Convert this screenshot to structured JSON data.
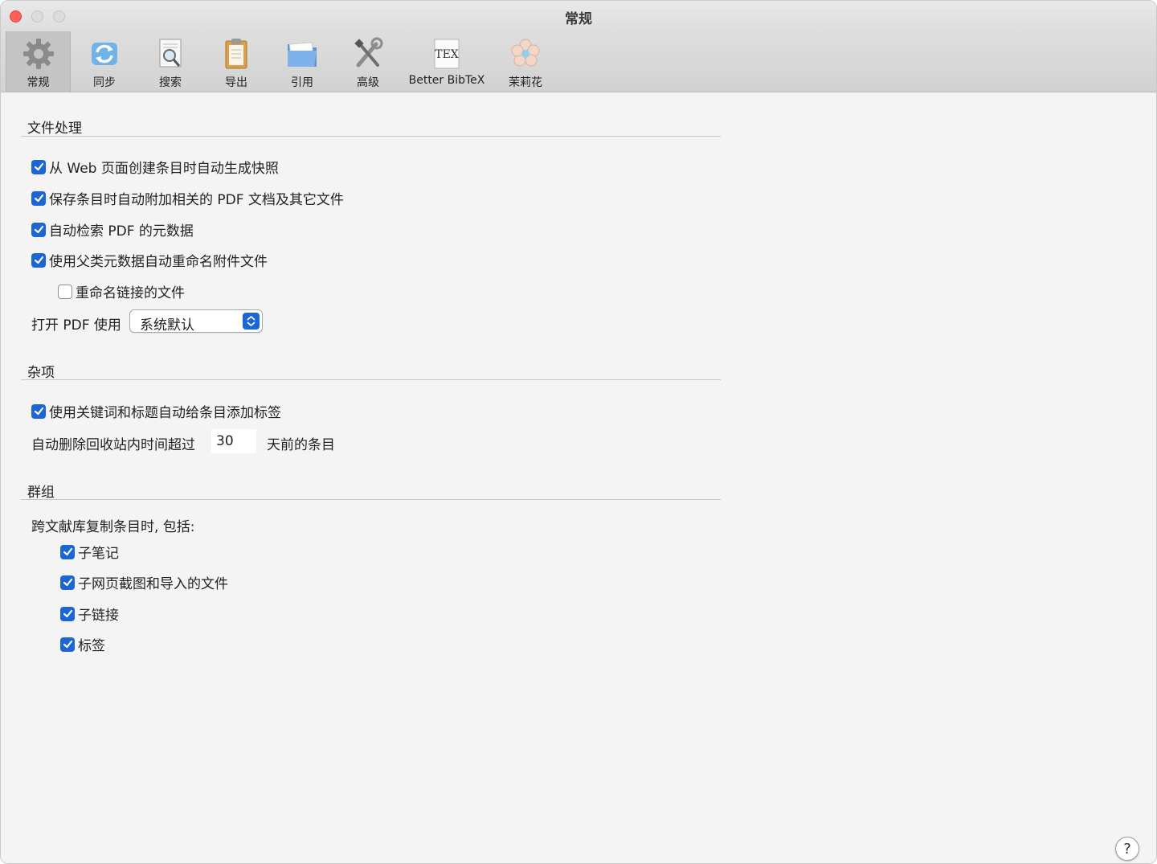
{
  "window": {
    "title": "常规"
  },
  "toolbar": {
    "items": [
      {
        "label": "常规",
        "icon": "gear-icon",
        "active": true
      },
      {
        "label": "同步",
        "icon": "sync-icon",
        "active": false
      },
      {
        "label": "搜索",
        "icon": "search-icon",
        "active": false
      },
      {
        "label": "导出",
        "icon": "clipboard-icon",
        "active": false
      },
      {
        "label": "引用",
        "icon": "folder-icon",
        "active": false
      },
      {
        "label": "高级",
        "icon": "tools-icon",
        "active": false
      },
      {
        "label": "Better BibTeX",
        "icon": "tex-icon",
        "active": false,
        "icon_text": "TEX"
      },
      {
        "label": "茉莉花",
        "icon": "flower-icon",
        "active": false
      }
    ]
  },
  "file_handling": {
    "title": "文件处理",
    "options": [
      {
        "label": "从 Web 页面创建条目时自动生成快照",
        "checked": true
      },
      {
        "label": "保存条目时自动附加相关的 PDF 文档及其它文件",
        "checked": true
      },
      {
        "label": "自动检索 PDF 的元数据",
        "checked": true
      },
      {
        "label": "使用父类元数据自动重命名附件文件",
        "checked": true
      },
      {
        "label": "重命名链接的文件",
        "checked": false
      }
    ],
    "open_pdf_label": "打开 PDF 使用",
    "open_pdf_value": "系统默认"
  },
  "misc": {
    "title": "杂项",
    "auto_tag_label": "使用关键词和标题自动给条目添加标签",
    "auto_tag_checked": true,
    "trash_prefix": "自动删除回收站内时间超过",
    "trash_days": "30",
    "trash_suffix": "天前的条目"
  },
  "groups": {
    "title": "群组",
    "copy_label": "跨文献库复制条目时, 包括:",
    "options": [
      {
        "label": "子笔记",
        "checked": true
      },
      {
        "label": "子网页截图和导入的文件",
        "checked": true
      },
      {
        "label": "子链接",
        "checked": true
      },
      {
        "label": "标签",
        "checked": true
      }
    ]
  },
  "help": {
    "label": "?"
  },
  "colors": {
    "accent": "#1a66d6",
    "close": "#fe5f57"
  }
}
